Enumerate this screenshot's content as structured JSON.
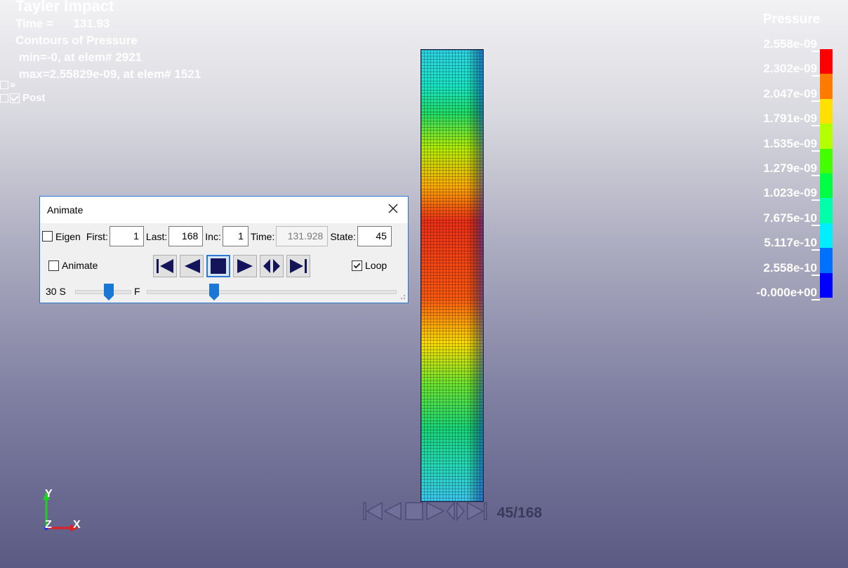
{
  "viewport": {
    "title": "Tayler Impact",
    "time_label": "Time =      131.93",
    "contours_label": "Contours of Pressure",
    "min_line": " min=-0, at elem# 2921",
    "max_line": " max=2.55829e-09, at elem# 1521",
    "tree_expand": "»",
    "tree_item": "Post",
    "frame_counter": "45/168"
  },
  "legend": {
    "title": "Pressure",
    "labels": [
      "2.558e-09",
      "2.302e-09",
      "2.047e-09",
      "1.791e-09",
      "1.535e-09",
      "1.279e-09",
      "1.023e-09",
      "7.675e-10",
      "5.117e-10",
      "2.558e-10",
      "-0.000e+00"
    ],
    "colors": [
      "#ff0000",
      "#ff7a00",
      "#ffe000",
      "#b4ff00",
      "#44ff00",
      "#00ff44",
      "#00ffaa",
      "#00eeff",
      "#0070ff",
      "#0000ff"
    ]
  },
  "animate_dialog": {
    "title": "Animate",
    "eigen_label": "Eigen",
    "eigen_checked": false,
    "first_label": "First:",
    "first_value": "1",
    "last_label": "Last:",
    "last_value": "168",
    "inc_label": "Inc:",
    "inc_value": "1",
    "time_label": "Time:",
    "time_value": "131.928",
    "state_label": "State:",
    "state_value": "45",
    "animate_label": "Animate",
    "animate_checked": false,
    "loop_label": "Loop",
    "loop_checked": true,
    "speed_label": "30 S",
    "fast_label": "F",
    "speed_slider_fraction": 0.62,
    "frame_slider_fraction": 0.27
  },
  "axes": {
    "y": "Y",
    "z": "Z",
    "x": "X"
  }
}
